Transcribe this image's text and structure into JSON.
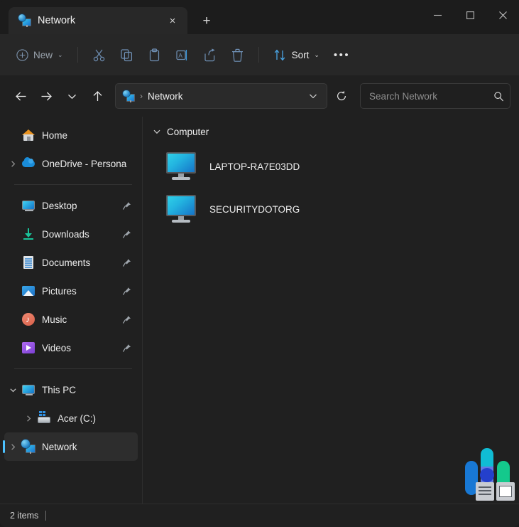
{
  "window": {
    "tab": {
      "title": "Network",
      "icon": "network-computer-icon",
      "close_label": "×",
      "new_tab_label": "+"
    },
    "controls": {
      "minimize": "—",
      "maximize": "□",
      "close": "✕"
    }
  },
  "toolbar": {
    "new_label": "New",
    "sort_label": "Sort",
    "items": [
      {
        "name": "cut",
        "icon": "scissors-icon"
      },
      {
        "name": "copy",
        "icon": "copy-icon"
      },
      {
        "name": "paste",
        "icon": "paste-icon"
      },
      {
        "name": "rename",
        "icon": "rename-icon"
      },
      {
        "name": "share",
        "icon": "share-icon"
      },
      {
        "name": "delete",
        "icon": "trash-icon"
      }
    ],
    "more_label": "•••"
  },
  "address": {
    "back": "←",
    "forward": "→",
    "recent": "⌄",
    "up": "↑",
    "breadcrumb_icon": "network-computer-icon",
    "breadcrumb_separator": "›",
    "breadcrumb": "Network",
    "dropdown": "⌄",
    "refresh": "⟳"
  },
  "search": {
    "placeholder": "Search Network",
    "icon": "search-icon"
  },
  "sidebar": {
    "items": [
      {
        "label": "Home",
        "icon": "home-icon",
        "expander": "",
        "pinned": false,
        "indent": 0,
        "selected": false
      },
      {
        "label": "OneDrive - Persona",
        "icon": "onedrive-icon",
        "expander": "›",
        "pinned": false,
        "indent": 0,
        "selected": false
      },
      {
        "separator": true
      },
      {
        "label": "Desktop",
        "icon": "desktop-icon",
        "expander": "",
        "pinned": true,
        "indent": 0,
        "selected": false
      },
      {
        "label": "Downloads",
        "icon": "downloads-icon",
        "expander": "",
        "pinned": true,
        "indent": 0,
        "selected": false
      },
      {
        "label": "Documents",
        "icon": "documents-icon",
        "expander": "",
        "pinned": true,
        "indent": 0,
        "selected": false
      },
      {
        "label": "Pictures",
        "icon": "pictures-icon",
        "expander": "",
        "pinned": true,
        "indent": 0,
        "selected": false
      },
      {
        "label": "Music",
        "icon": "music-icon",
        "expander": "",
        "pinned": true,
        "indent": 0,
        "selected": false
      },
      {
        "label": "Videos",
        "icon": "videos-icon",
        "expander": "",
        "pinned": true,
        "indent": 0,
        "selected": false
      },
      {
        "separator": true
      },
      {
        "label": "This PC",
        "icon": "this-pc-icon",
        "expander": "⌄",
        "pinned": false,
        "indent": 0,
        "selected": false
      },
      {
        "label": "Acer (C:)",
        "icon": "drive-icon",
        "expander": "›",
        "pinned": false,
        "indent": 1,
        "selected": false
      },
      {
        "label": "Network",
        "icon": "network-computer-icon",
        "expander": "›",
        "pinned": false,
        "indent": 0,
        "selected": true
      }
    ],
    "pin_glyph": "📌"
  },
  "content": {
    "group": {
      "chevron": "⌄",
      "title": "Computer"
    },
    "items": [
      {
        "name": "LAPTOP-RA7E03DD",
        "icon": "monitor-icon"
      },
      {
        "name": "SECURITYDOTORG",
        "icon": "monitor-icon"
      }
    ]
  },
  "status": {
    "item_count": "2 items"
  },
  "colors": {
    "accent": "#4cc2ff",
    "window_bg": "#202020",
    "commandbar_bg": "#272727",
    "logo_blue": "#1878d4",
    "logo_cyan": "#10bcd4",
    "logo_green": "#14c98c",
    "logo_purple": "#7b68e8",
    "logo_dot": "#2440cc"
  }
}
